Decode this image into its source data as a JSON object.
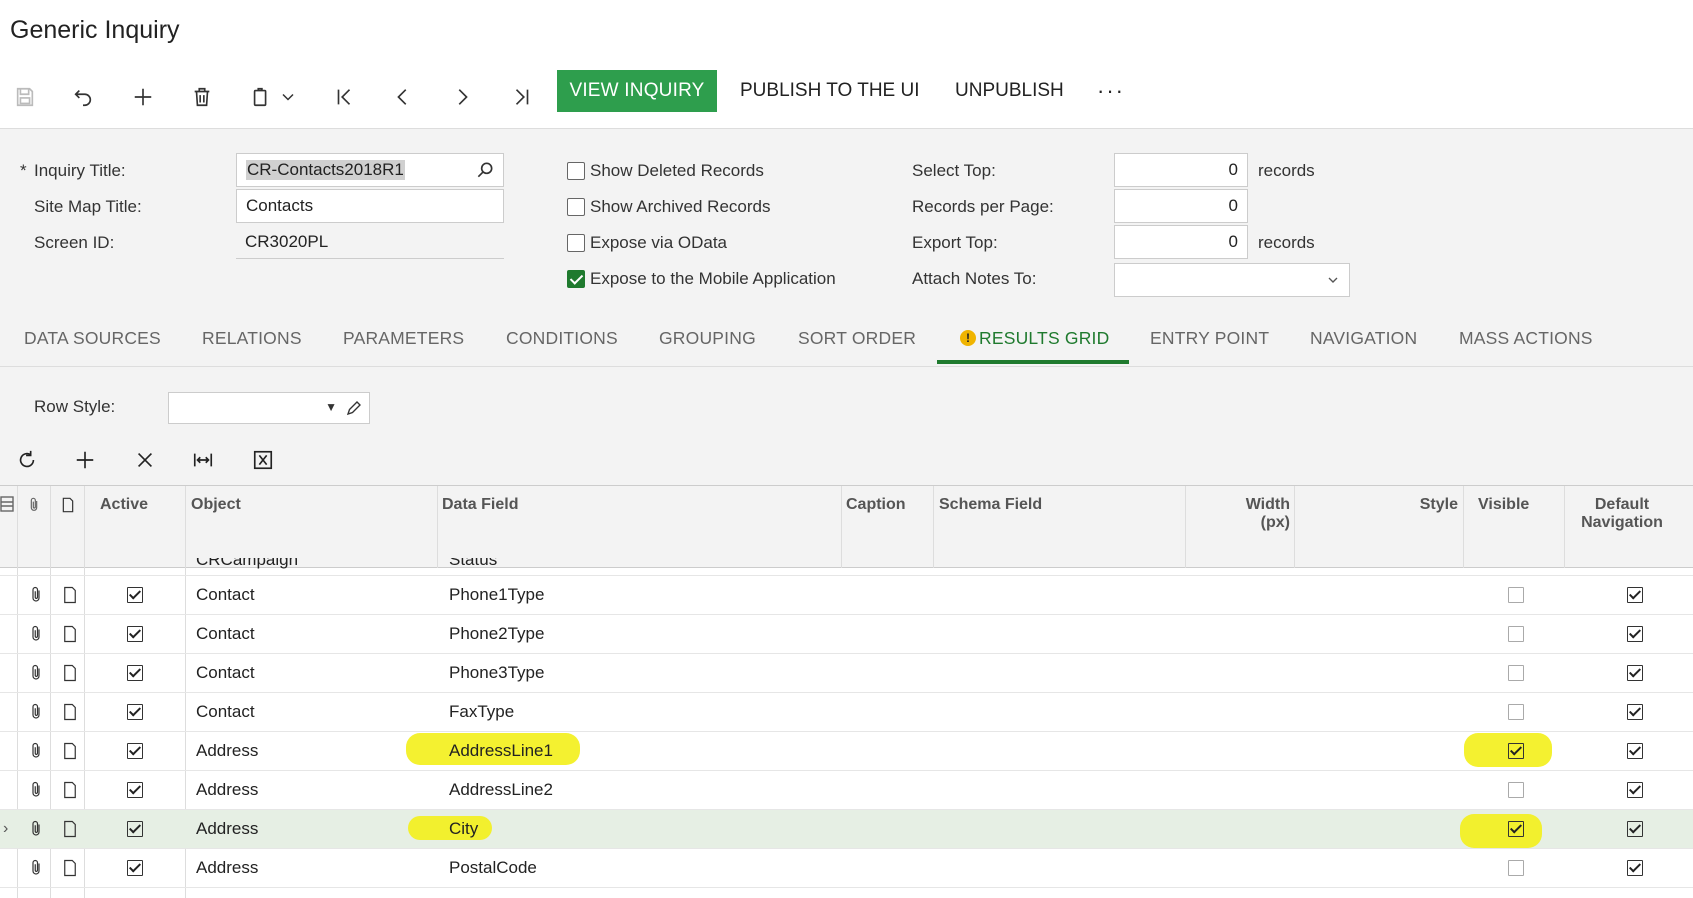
{
  "page_title": "Generic Inquiry",
  "toolbar": {
    "view_inquiry": "VIEW INQUIRY",
    "publish": "PUBLISH TO THE UI",
    "unpublish": "UNPUBLISH",
    "more": "···"
  },
  "form": {
    "inquiry_title_label": "Inquiry Title:",
    "required_mark": "*",
    "inquiry_title_value": "CR-Contacts2018R1",
    "site_map_title_label": "Site Map Title:",
    "site_map_title_value": "Contacts",
    "screen_id_label": "Screen ID:",
    "screen_id_value": "CR3020PL",
    "show_deleted_label": "Show Deleted Records",
    "show_deleted_checked": false,
    "show_archived_label": "Show Archived Records",
    "show_archived_checked": false,
    "expose_odata_label": "Expose via OData",
    "expose_odata_checked": false,
    "expose_mobile_label": "Expose to the Mobile Application",
    "expose_mobile_checked": true,
    "select_top_label": "Select Top:",
    "select_top_value": "0",
    "select_top_unit": "records",
    "records_per_page_label": "Records per Page:",
    "records_per_page_value": "0",
    "export_top_label": "Export Top:",
    "export_top_value": "0",
    "export_top_unit": "records",
    "attach_notes_label": "Attach Notes To:",
    "attach_notes_value": ""
  },
  "tabs": [
    {
      "label": "DATA SOURCES"
    },
    {
      "label": "RELATIONS"
    },
    {
      "label": "PARAMETERS"
    },
    {
      "label": "CONDITIONS"
    },
    {
      "label": "GROUPING"
    },
    {
      "label": "SORT ORDER"
    },
    {
      "label": "RESULTS GRID",
      "active": true,
      "warning": true
    },
    {
      "label": "ENTRY POINT"
    },
    {
      "label": "NAVIGATION"
    },
    {
      "label": "MASS ACTIONS"
    }
  ],
  "results_grid": {
    "row_style_label": "Row Style:",
    "row_style_value": "",
    "columns": {
      "active": "Active",
      "object": "Object",
      "data_field": "Data Field",
      "caption": "Caption",
      "schema_field": "Schema Field",
      "width": "Width (px)",
      "style": "Style",
      "visible": "Visible",
      "default_navigation": "Default Navigation"
    },
    "partial_row": {
      "object": "CRCampaign",
      "data_field": "Status"
    },
    "rows": [
      {
        "object": "Contact",
        "data_field": "Phone1Type",
        "active": true,
        "visible": false,
        "default_navigation": true
      },
      {
        "object": "Contact",
        "data_field": "Phone2Type",
        "active": true,
        "visible": false,
        "default_navigation": true
      },
      {
        "object": "Contact",
        "data_field": "Phone3Type",
        "active": true,
        "visible": false,
        "default_navigation": true
      },
      {
        "object": "Contact",
        "data_field": "FaxType",
        "active": true,
        "visible": false,
        "default_navigation": true
      },
      {
        "object": "Address",
        "data_field": "AddressLine1",
        "active": true,
        "visible": true,
        "default_navigation": true,
        "highlighted": true
      },
      {
        "object": "Address",
        "data_field": "AddressLine2",
        "active": true,
        "visible": false,
        "default_navigation": true
      },
      {
        "object": "Address",
        "data_field": "City",
        "active": true,
        "visible": true,
        "default_navigation": true,
        "highlighted": true,
        "selected": true
      },
      {
        "object": "Address",
        "data_field": "PostalCode",
        "active": true,
        "visible": false,
        "default_navigation": true
      }
    ]
  },
  "colors": {
    "accent": "#1f7a2e",
    "primary_button": "#2e9e4d",
    "highlight": "#f3f01a",
    "warning": "#f0b400"
  }
}
